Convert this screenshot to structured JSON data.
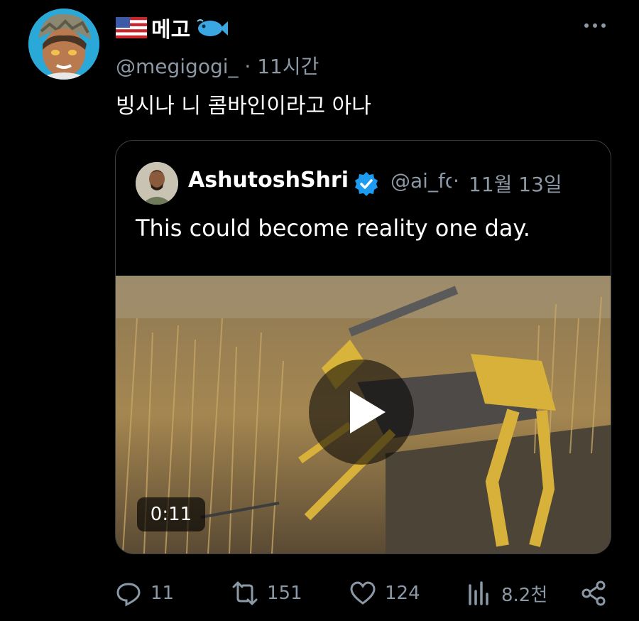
{
  "tweet": {
    "display_name": "메고",
    "handle": "@megigogi_",
    "separator": "·",
    "time": "11시간",
    "text": "빙시나 니 콤바인이라고 아나",
    "more_icon": "ellipsis-icon",
    "badges": [
      "us-flag-icon",
      "fish-emoji-icon"
    ]
  },
  "quoted": {
    "display_name": "AshutoshShrivastava",
    "verified": true,
    "verified_color": "#1d9bf0",
    "handle": "@ai_for_success",
    "separator": "·",
    "date": "11월 13일",
    "text": "This could become reality one day.",
    "video": {
      "duration": "0:11",
      "play_icon": "play-icon"
    }
  },
  "actions": {
    "reply_count": "11",
    "retweet_count": "151",
    "like_count": "124",
    "views_count": "8.2천",
    "share_icon": "share-icon"
  },
  "colors": {
    "background": "#000000",
    "secondary_text": "#8b98a5",
    "border": "#3a3f45"
  }
}
